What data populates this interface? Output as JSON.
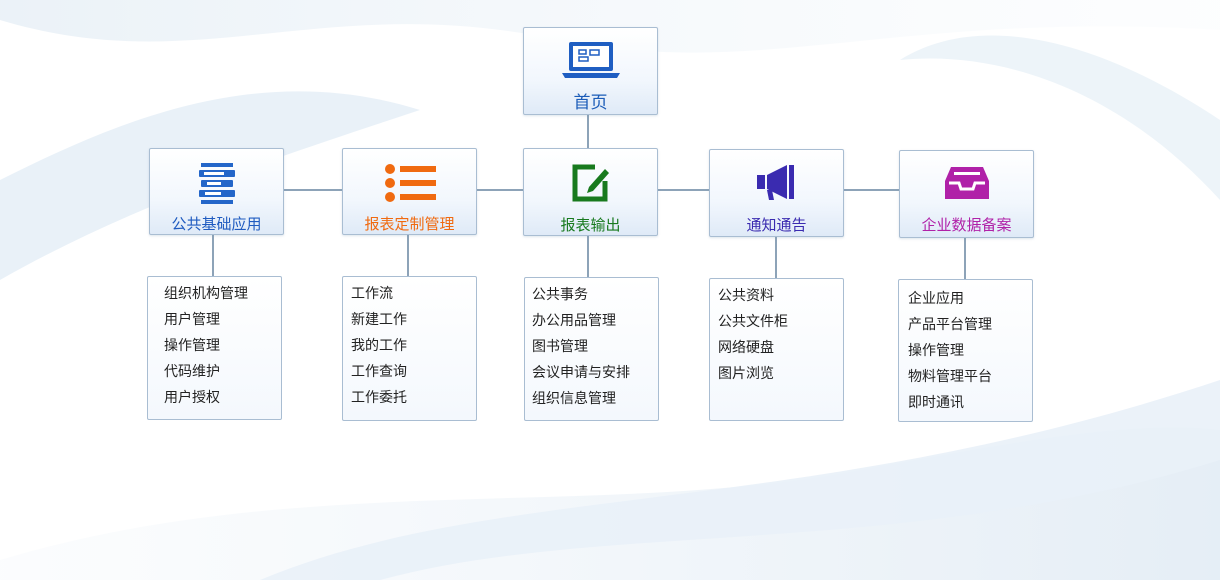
{
  "root": {
    "label": "首页",
    "color": "#1b5cb8",
    "icon": "laptop-icon"
  },
  "categories": [
    {
      "label": "公共基础应用",
      "color": "#1f5bc0",
      "icon": "database-stack-icon",
      "items": [
        "组织机构管理",
        "用户管理",
        "操作管理",
        "代码维护",
        "用户授权"
      ]
    },
    {
      "label": "报表定制管理",
      "color": "#f06a10",
      "icon": "list-icon",
      "items": [
        "工作流",
        "新建工作",
        "我的工作",
        "工作查询",
        "工作委托"
      ]
    },
    {
      "label": "报表输出",
      "color": "#187a1e",
      "icon": "edit-icon",
      "items": [
        "公共事务",
        "办公用品管理",
        "图书管理",
        "会议申请与安排",
        "组织信息管理"
      ]
    },
    {
      "label": "通知通告",
      "color": "#3a2bb0",
      "icon": "megaphone-icon",
      "items": [
        "公共资料",
        "公共文件柜",
        "网络硬盘",
        "图片浏览"
      ]
    },
    {
      "label": "企业数据备案",
      "color": "#b021a8",
      "icon": "inbox-tray-icon",
      "items": [
        "企业应用",
        "产品平台管理",
        "操作管理",
        "物料管理平台",
        "即时通讯"
      ]
    }
  ]
}
